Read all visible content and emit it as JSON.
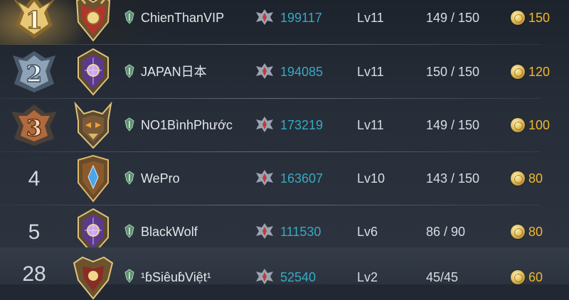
{
  "leaderboard": {
    "rows": [
      {
        "rank": "1",
        "name": "ChienThanVIP",
        "power": "199117",
        "level": "Lv11",
        "progress": "149 / 150",
        "reward": "150",
        "medal": "gold-medal-icon",
        "avatar": "red-gold-crest-avatar"
      },
      {
        "rank": "2",
        "name": "JAPAN日本",
        "power": "194085",
        "level": "Lv11",
        "progress": "150 / 150",
        "reward": "120",
        "medal": "silver-medal-icon",
        "avatar": "purple-crest-avatar"
      },
      {
        "rank": "3",
        "name": "NO1BìnhPhước",
        "power": "173219",
        "level": "Lv11",
        "progress": "149 / 150",
        "reward": "100",
        "medal": "bronze-medal-icon",
        "avatar": "horned-crest-avatar"
      },
      {
        "rank": "4",
        "name": "WePro",
        "power": "163607",
        "level": "Lv10",
        "progress": "143 / 150",
        "reward": "80",
        "avatar": "blue-shield-avatar"
      },
      {
        "rank": "5",
        "name": "BlackWolf",
        "power": "111530",
        "level": "Lv6",
        "progress": "86 / 90",
        "reward": "80",
        "avatar": "purple-crest-avatar"
      },
      {
        "rank": "28",
        "name": "¹ɓSiêuɓViệt¹",
        "power": "52540",
        "level": "Lv2",
        "progress": "45/45",
        "reward": "60",
        "avatar": "winged-crest-avatar"
      }
    ]
  },
  "colors": {
    "power": "#37a9c4",
    "reward": "#f2b82c",
    "gold": "#e9c46a",
    "silver": "#8fa3b8",
    "bronze": "#b06a3c"
  },
  "icons": {
    "player": "player-emblem-icon",
    "power": "power-crest-icon",
    "reward": "gold-coin-icon"
  }
}
